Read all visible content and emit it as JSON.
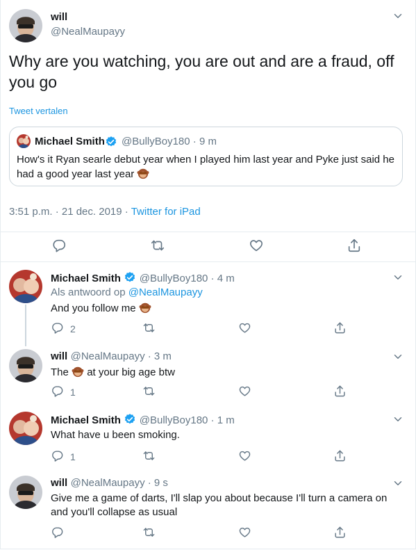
{
  "main_tweet": {
    "name": "will",
    "handle": "@NealMaupayy",
    "text": "Why are you watching, you are out and are a fraud, off you go",
    "translate_label": "Tweet vertalen",
    "time": "3:51 p.m. · 21 dec. 2019 ·",
    "source": "Twitter for iPad"
  },
  "quoted": {
    "name": "Michael Smith",
    "handle": "@BullyBoy180 · 9 m",
    "text": "How's it Ryan searle debut year when I played him last year and Pyke just said he had a good year last year"
  },
  "replies": [
    {
      "name": "Michael Smith",
      "handle": "@BullyBoy180 · 4 m",
      "reply_prefix": "Als antwoord op",
      "reply_to": "@NealMaupayy",
      "text": "And you follow me",
      "reply_count": "2"
    },
    {
      "name": "will",
      "handle": "@NealMaupayy · 3 m",
      "text_before": "The",
      "text_after": "at your big age btw",
      "reply_count": "1"
    },
    {
      "name": "Michael Smith",
      "handle": "@BullyBoy180 · 1 m",
      "text": "What have u been smoking.",
      "reply_count": "1"
    },
    {
      "name": "will",
      "handle": "@NealMaupayy · 9 s",
      "text": "Give me a game of darts, I'll slap you about because I'll turn a camera on and you'll collapse as usual"
    }
  ],
  "colors": {
    "accent": "#1b95e0",
    "muted": "#657786",
    "verified": "#1da1f2"
  }
}
